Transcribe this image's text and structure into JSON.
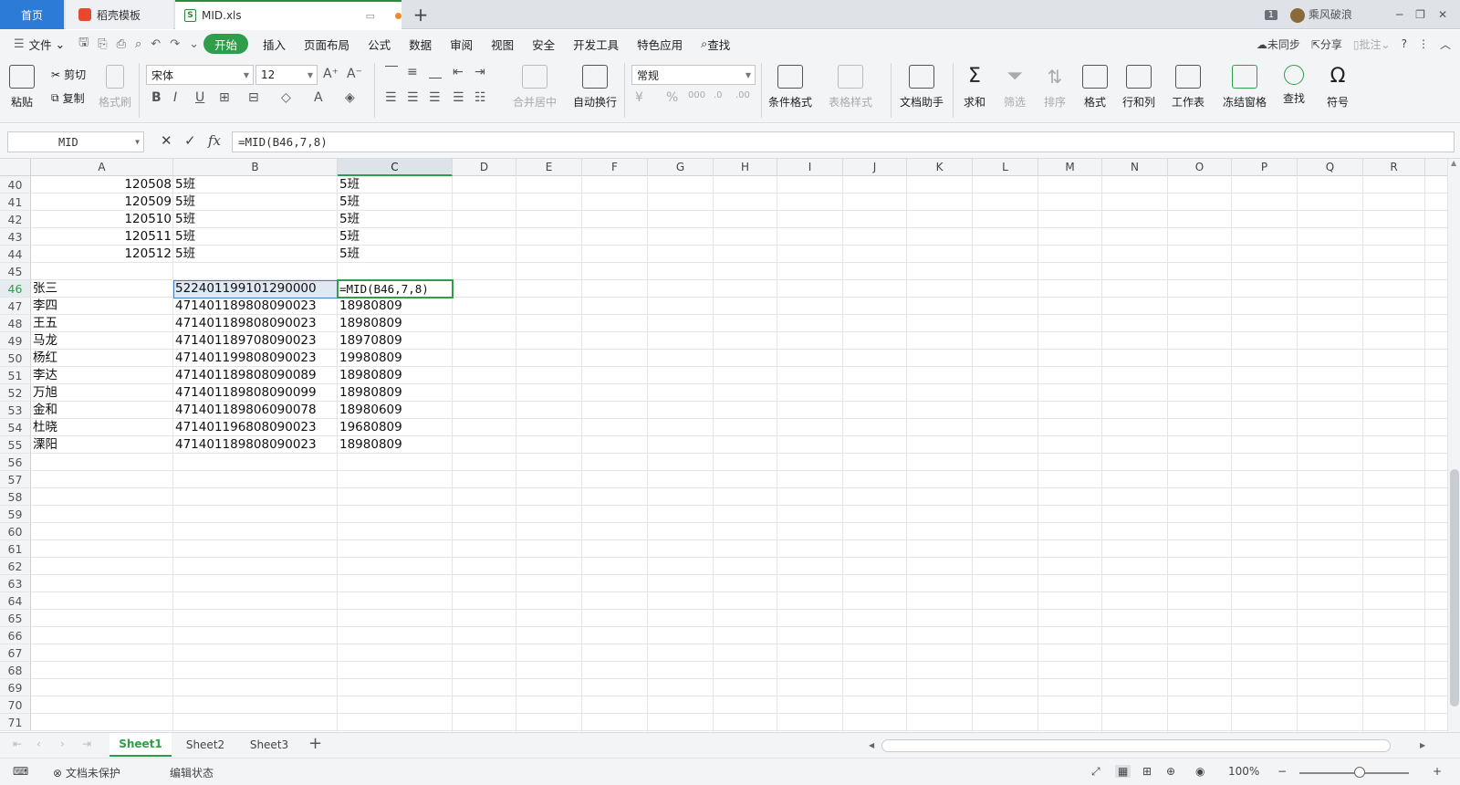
{
  "titlebar": {
    "tabs": [
      "首页",
      "稻壳模板",
      "MID.xls"
    ],
    "badge": "1",
    "user": "乘风破浪"
  },
  "menubar": {
    "file": "文件",
    "items": [
      "开始",
      "插入",
      "页面布局",
      "公式",
      "数据",
      "审阅",
      "视图",
      "安全",
      "开发工具",
      "特色应用"
    ],
    "search": "查找",
    "right": [
      "未同步",
      "分享",
      "批注"
    ]
  },
  "ribbon": {
    "paste": "粘贴",
    "cut": "剪切",
    "copy": "复制",
    "format_painter": "格式刷",
    "font_name": "宋体",
    "font_size": "12",
    "merge": "合并居中",
    "wrap": "自动换行",
    "number_format": "常规",
    "cond_format": "条件格式",
    "table_style": "表格样式",
    "doc_assist": "文档助手",
    "sum": "求和",
    "filter": "筛选",
    "sort": "排序",
    "format": "格式",
    "rowcol": "行和列",
    "worksheet": "工作表",
    "freeze": "冻结窗格",
    "find": "查找",
    "symbol": "符号"
  },
  "formula_bar": {
    "name_box": "MID",
    "formula": "=MID(B46,7,8)"
  },
  "grid": {
    "columns": [
      "A",
      "B",
      "C",
      "D",
      "E",
      "F",
      "G",
      "H",
      "I",
      "J",
      "K",
      "L",
      "M",
      "N",
      "O",
      "P",
      "Q",
      "R"
    ],
    "rows": [
      {
        "n": "40",
        "a": "120508",
        "b": "5班",
        "c": "5班"
      },
      {
        "n": "41",
        "a": "120509",
        "b": "5班",
        "c": "5班"
      },
      {
        "n": "42",
        "a": "120510",
        "b": "5班",
        "c": "5班"
      },
      {
        "n": "43",
        "a": "120511",
        "b": "5班",
        "c": "5班"
      },
      {
        "n": "44",
        "a": "120512",
        "b": "5班",
        "c": "5班"
      },
      {
        "n": "45",
        "a": "",
        "b": "",
        "c": ""
      },
      {
        "n": "46",
        "a": "张三",
        "b": "522401199101290000",
        "c": "=MID(B46,7,8)"
      },
      {
        "n": "47",
        "a": "李四",
        "b": "471401189808090023",
        "c": "18980809"
      },
      {
        "n": "48",
        "a": "王五",
        "b": "471401189808090023",
        "c": "18980809"
      },
      {
        "n": "49",
        "a": "马龙",
        "b": "471401189708090023",
        "c": "18970809"
      },
      {
        "n": "50",
        "a": "杨红",
        "b": "471401199808090023",
        "c": "19980809"
      },
      {
        "n": "51",
        "a": "李达",
        "b": "471401189808090089",
        "c": "18980809"
      },
      {
        "n": "52",
        "a": "万旭",
        "b": "471401189808090099",
        "c": "18980809"
      },
      {
        "n": "53",
        "a": "金和",
        "b": "471401189806090078",
        "c": "18980609"
      },
      {
        "n": "54",
        "a": "杜晓",
        "b": "471401196808090023",
        "c": "19680809"
      },
      {
        "n": "55",
        "a": "溧阳",
        "b": "471401189808090023",
        "c": "18980809"
      },
      {
        "n": "56",
        "a": "",
        "b": "",
        "c": ""
      },
      {
        "n": "57",
        "a": "",
        "b": "",
        "c": ""
      },
      {
        "n": "58",
        "a": "",
        "b": "",
        "c": ""
      },
      {
        "n": "59",
        "a": "",
        "b": "",
        "c": ""
      },
      {
        "n": "60",
        "a": "",
        "b": "",
        "c": ""
      },
      {
        "n": "61",
        "a": "",
        "b": "",
        "c": ""
      },
      {
        "n": "62",
        "a": "",
        "b": "",
        "c": ""
      },
      {
        "n": "63",
        "a": "",
        "b": "",
        "c": ""
      },
      {
        "n": "64",
        "a": "",
        "b": "",
        "c": ""
      },
      {
        "n": "65",
        "a": "",
        "b": "",
        "c": ""
      },
      {
        "n": "66",
        "a": "",
        "b": "",
        "c": ""
      },
      {
        "n": "67",
        "a": "",
        "b": "",
        "c": ""
      },
      {
        "n": "68",
        "a": "",
        "b": "",
        "c": ""
      },
      {
        "n": "69",
        "a": "",
        "b": "",
        "c": ""
      },
      {
        "n": "70",
        "a": "",
        "b": "",
        "c": ""
      },
      {
        "n": "71",
        "a": "",
        "b": "",
        "c": ""
      }
    ],
    "active_row": "46",
    "active_col": "C"
  },
  "sheets": [
    "Sheet1",
    "Sheet2",
    "Sheet3"
  ],
  "statusbar": {
    "protect": "文档未保护",
    "mode": "编辑状态",
    "zoom": "100%"
  },
  "colors": {
    "accent": "#2e9e4a",
    "home_tab": "#2b7bd7",
    "selection": "#4a7fc0"
  }
}
